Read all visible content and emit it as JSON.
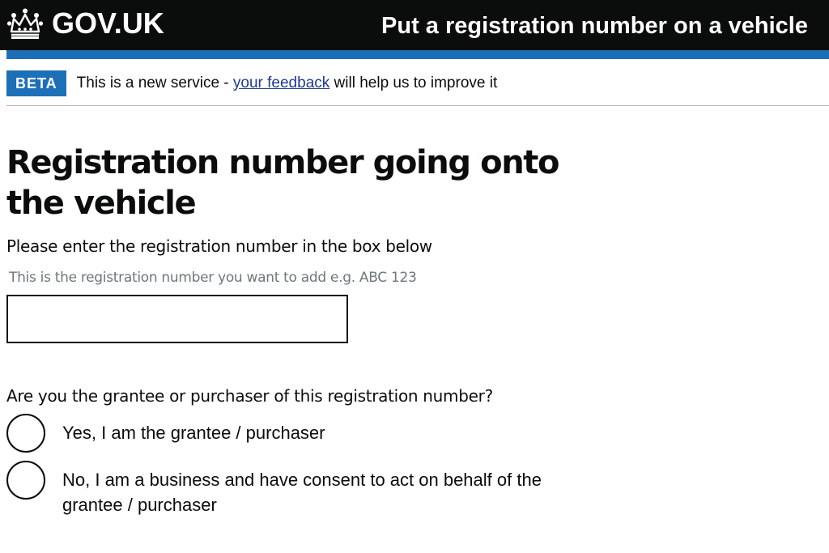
{
  "header": {
    "logo_text": "GOV.UK",
    "logo_icon": "crown-icon",
    "service_name": "Put a registration number on a vehicle"
  },
  "phase_banner": {
    "tag": "BETA",
    "text_before": "This is a new service - ",
    "link_text": "your feedback",
    "text_after": " will help us to improve it"
  },
  "main": {
    "title": "Registration number going onto the vehicle",
    "instruction": "Please enter the registration number in the box below",
    "hint": "This is the registration number you want to add e.g. ABC 123",
    "input_value": "",
    "question": "Are you the grantee or purchaser of this registration number?",
    "options": [
      {
        "label": "Yes, I am the grantee / purchaser"
      },
      {
        "label": "No, I am a business and have consent to act on behalf of the grantee / purchaser"
      }
    ]
  },
  "colors": {
    "header_bg": "#0b0c0c",
    "brand_blue": "#1d70b8",
    "link": "#1d3a8f",
    "hint_grey": "#6f777b"
  }
}
